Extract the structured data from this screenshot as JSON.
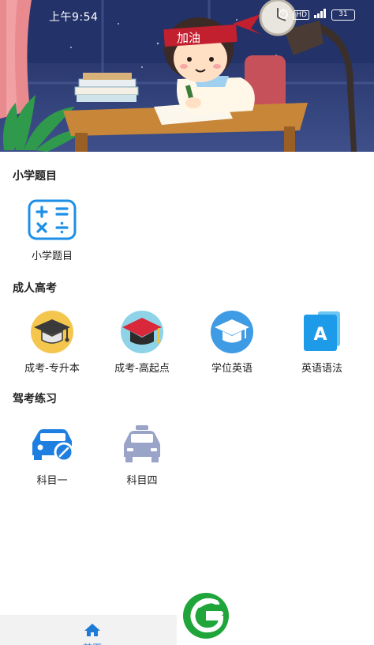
{
  "status_bar": {
    "time": "上午9:54",
    "battery": "31",
    "network": "HD"
  },
  "banner": {
    "headband_text": "加油"
  },
  "sections": [
    {
      "title": "小学题目",
      "items": [
        {
          "label": "小学题目",
          "icon": "math-operators-icon"
        }
      ]
    },
    {
      "title": "成人高考",
      "items": [
        {
          "label": "成考-专升本",
          "icon": "graduation-cap-icon"
        },
        {
          "label": "成考-高起点",
          "icon": "graduation-cap-red-icon"
        },
        {
          "label": "学位英语",
          "icon": "degree-cap-icon"
        },
        {
          "label": "英语语法",
          "icon": "letter-a-book-icon"
        }
      ]
    },
    {
      "title": "驾考练习",
      "items": [
        {
          "label": "科目一",
          "icon": "car-icon"
        },
        {
          "label": "科目四",
          "icon": "taxi-icon"
        }
      ]
    }
  ],
  "tab_bar": {
    "items": [
      {
        "label": "首页",
        "icon": "home-icon",
        "active": true
      }
    ]
  },
  "colors": {
    "accent": "#1f7ad6",
    "icon_blue": "#2196f3"
  }
}
